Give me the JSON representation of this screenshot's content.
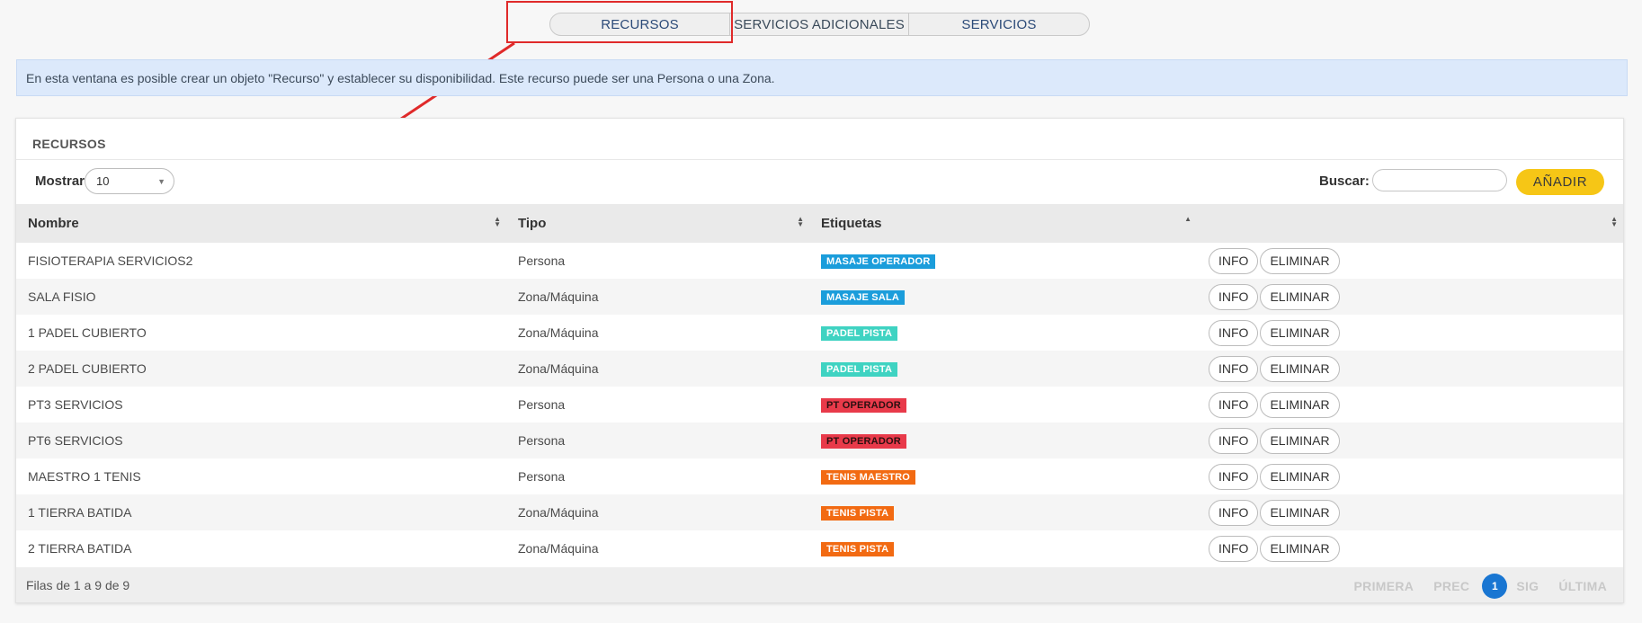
{
  "tabs": [
    "RECURSOS",
    "SERVICIOS ADICIONALES",
    "SERVICIOS"
  ],
  "banner": "En esta ventana es posible crear un objeto \"Recurso\" y establecer su disponibilidad. Este recurso puede ser una Persona o una Zona.",
  "panel": {
    "title": "RECURSOS",
    "show_label": "Mostrar",
    "show_value": "10",
    "search_label": "Buscar:",
    "search_value": "",
    "add_label": "AÑADIR"
  },
  "table": {
    "columns": [
      "Nombre",
      "Tipo",
      "Etiquetas",
      ""
    ],
    "info_label": "INFO",
    "delete_label": "ELIMINAR",
    "rows": [
      {
        "name": "FISIOTERAPIA SERVICIOS2",
        "type": "Persona",
        "tag": "MASAJE OPERADOR",
        "tag_color": "#1b9ddb"
      },
      {
        "name": "SALA FISIO",
        "type": "Zona/Máquina",
        "tag": "MASAJE SALA",
        "tag_color": "#1b9ddb"
      },
      {
        "name": "1 PADEL CUBIERTO",
        "type": "Zona/Máquina",
        "tag": "PADEL PISTA",
        "tag_color": "#3fd3c2"
      },
      {
        "name": "2 PADEL CUBIERTO",
        "type": "Zona/Máquina",
        "tag": "PADEL PISTA",
        "tag_color": "#3fd3c2"
      },
      {
        "name": "PT3 SERVICIOS",
        "type": "Persona",
        "tag": "PT OPERADOR",
        "tag_color": "#e83a4a"
      },
      {
        "name": "PT6 SERVICIOS",
        "type": "Persona",
        "tag": "PT OPERADOR",
        "tag_color": "#e83a4a"
      },
      {
        "name": "MAESTRO 1 TENIS",
        "type": "Persona",
        "tag": "TENIS MAESTRO",
        "tag_color": "#f26a12"
      },
      {
        "name": "1 TIERRA BATIDA",
        "type": "Zona/Máquina",
        "tag": "TENIS PISTA",
        "tag_color": "#f26a12"
      },
      {
        "name": "2 TIERRA BATIDA",
        "type": "Zona/Máquina",
        "tag": "TENIS PISTA",
        "tag_color": "#f26a12"
      }
    ]
  },
  "footer": {
    "rows_info": "Filas de 1 a 9 de 9",
    "first": "PRIMERA",
    "prev": "PREC",
    "current_page": "1",
    "next": "SIG",
    "last": "ÚLTIMA"
  }
}
